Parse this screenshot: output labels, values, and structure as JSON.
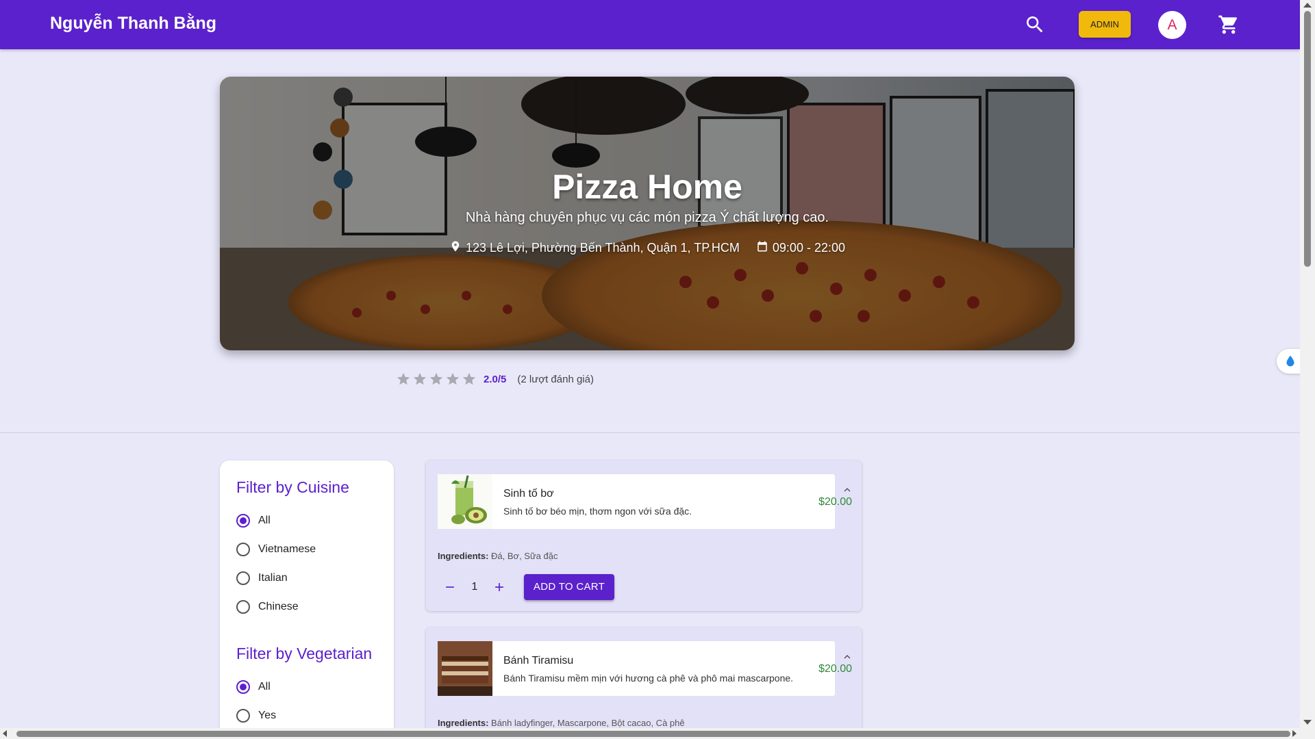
{
  "header": {
    "brand": "Nguyễn Thanh Bằng",
    "admin_label": "ADMIN",
    "avatar_letter": "A",
    "accent_color": "#5b21cc"
  },
  "hero": {
    "title": "Pizza Home",
    "description": "Nhà hàng chuyên phục vụ các món pizza Ý chất lượng cao.",
    "address": "123 Lê Lợi, Phường Bến Thành, Quận 1, TP.HCM",
    "hours": "09:00 - 22:00"
  },
  "rating": {
    "value_text": "2.0/5",
    "count_text": "(2 lượt đánh giá)",
    "stars_filled": 0,
    "stars_total": 5
  },
  "filters": {
    "cuisine_title": "Filter by Cuisine",
    "cuisine_options": [
      "All",
      "Vietnamese",
      "Italian",
      "Chinese"
    ],
    "cuisine_selected": "All",
    "vegetarian_title": "Filter by Vegetarian",
    "vegetarian_options": [
      "All",
      "Yes"
    ],
    "vegetarian_selected": "All"
  },
  "menu": [
    {
      "name": "Sinh tố bơ",
      "description": "Sinh tố bơ béo mịn, thơm ngon với sữa đặc.",
      "price": "$20.00",
      "ingredients_label": "Ingredients:",
      "ingredients": "Đá, Bơ, Sữa đặc",
      "quantity": "1",
      "add_label": "ADD TO CART"
    },
    {
      "name": "Bánh Tiramisu",
      "description": "Bánh Tiramisu mềm mịn với hương cà phê và phô mai mascarpone.",
      "price": "$20.00",
      "ingredients_label": "Ingredients:",
      "ingredients": "Bánh ladyfinger, Mascarpone, Bột cacao, Cà phê"
    }
  ]
}
